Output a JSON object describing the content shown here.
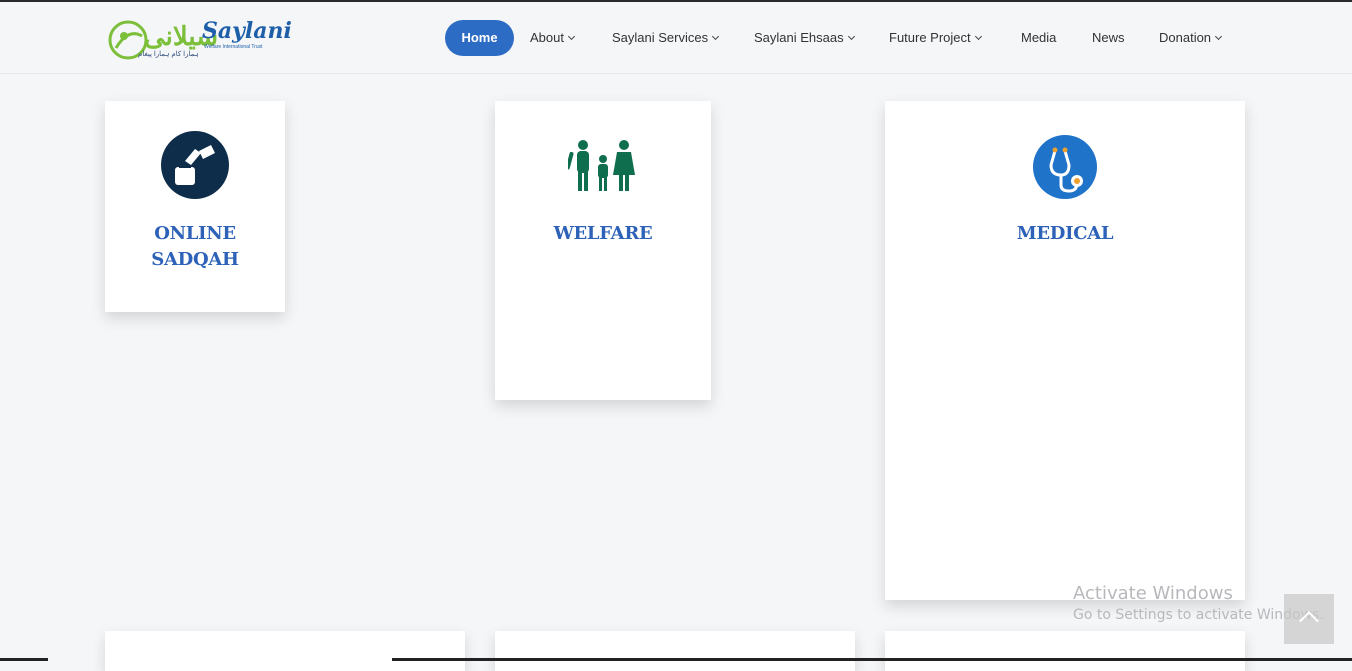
{
  "logo": {
    "urdu": "سیلانی",
    "latin": "Saylani",
    "tagline": "Welfare International Trust",
    "urdu_sub": "ہمارا کام ہمارا پیغام"
  },
  "nav": {
    "items": [
      {
        "label": "Home",
        "dropdown": false,
        "active": true
      },
      {
        "label": "About",
        "dropdown": true
      },
      {
        "label": "Saylani Services",
        "dropdown": true
      },
      {
        "label": "Saylani Ehsaas",
        "dropdown": true
      },
      {
        "label": "Future Project",
        "dropdown": true
      },
      {
        "label": "Media",
        "dropdown": false
      },
      {
        "label": "News",
        "dropdown": false
      },
      {
        "label": "Donation",
        "dropdown": true
      }
    ]
  },
  "cards": [
    {
      "title_line1": "ONLINE",
      "title_line2": "SADQAH",
      "icon": "donation-box-icon"
    },
    {
      "title_line1": "WELFARE",
      "icon": "family-icon"
    },
    {
      "title_line1": "MEDICAL",
      "icon": "stethoscope-icon"
    }
  ],
  "watermark": {
    "title": "Activate Windows",
    "subtitle": "Go to Settings to activate Windows."
  },
  "colors": {
    "accent": "#2d6cc4",
    "card_title": "#2d62b8",
    "welfare_green": "#0f6e4e",
    "sadqah_navy": "#0e2d4a",
    "medical_blue": "#1f73c8"
  }
}
